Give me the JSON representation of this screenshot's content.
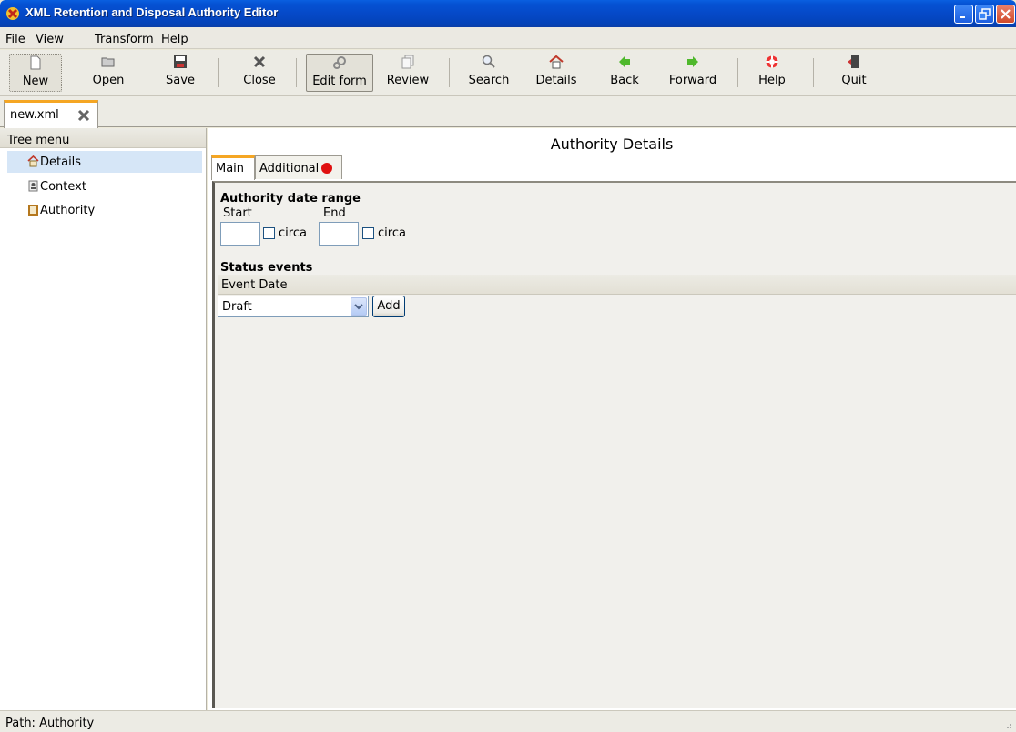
{
  "window": {
    "title": "XML Retention and Disposal Authority Editor",
    "icon": "app-logo-icon"
  },
  "menu": [
    "File",
    "View",
    "Transform",
    "Help"
  ],
  "toolbar": [
    {
      "label": "New",
      "icon": "new-document-icon"
    },
    {
      "label": "Open",
      "icon": "open-folder-icon"
    },
    {
      "label": "Save",
      "icon": "save-disk-icon"
    },
    {
      "label": "Close",
      "icon": "close-x-icon"
    },
    {
      "label": "Edit form",
      "icon": "gears-icon",
      "pressed": true
    },
    {
      "label": "Review",
      "icon": "review-pages-icon"
    },
    {
      "label": "Search",
      "icon": "magnifier-icon"
    },
    {
      "label": "Details",
      "icon": "home-icon"
    },
    {
      "label": "Back",
      "icon": "green-left-arrow-icon"
    },
    {
      "label": "Forward",
      "icon": "green-right-arrow-icon"
    },
    {
      "label": "Help",
      "icon": "lifebuoy-icon"
    },
    {
      "label": "Quit",
      "icon": "exit-door-icon"
    }
  ],
  "file_tab": {
    "label": "new.xml",
    "close_icon": "close-tab-icon"
  },
  "tree": {
    "header": "Tree menu",
    "items": [
      {
        "label": "Details",
        "icon": "home-icon",
        "selected": true
      },
      {
        "label": "Context",
        "icon": "person-card-icon"
      },
      {
        "label": "Authority",
        "icon": "clipboard-icon"
      }
    ]
  },
  "content": {
    "title": "Authority Details",
    "tabs": [
      {
        "label": "Main",
        "active": true
      },
      {
        "label": "Additional",
        "badge": "red-dot"
      }
    ],
    "date_range": {
      "heading": "Authority date range",
      "start_label": "Start",
      "end_label": "End",
      "start_value": "",
      "end_value": "",
      "circa_label": "circa",
      "start_circa": false,
      "end_circa": false
    },
    "status_events": {
      "heading": "Status events",
      "column_header": "Event Date",
      "selected_status": "Draft",
      "add_label": "Add"
    }
  },
  "statusbar": {
    "path": "Path:  Authority"
  },
  "colors": {
    "titlebar": "#0549c8",
    "accent_tab": "#f5a623",
    "selection": "#d6e6f7"
  }
}
